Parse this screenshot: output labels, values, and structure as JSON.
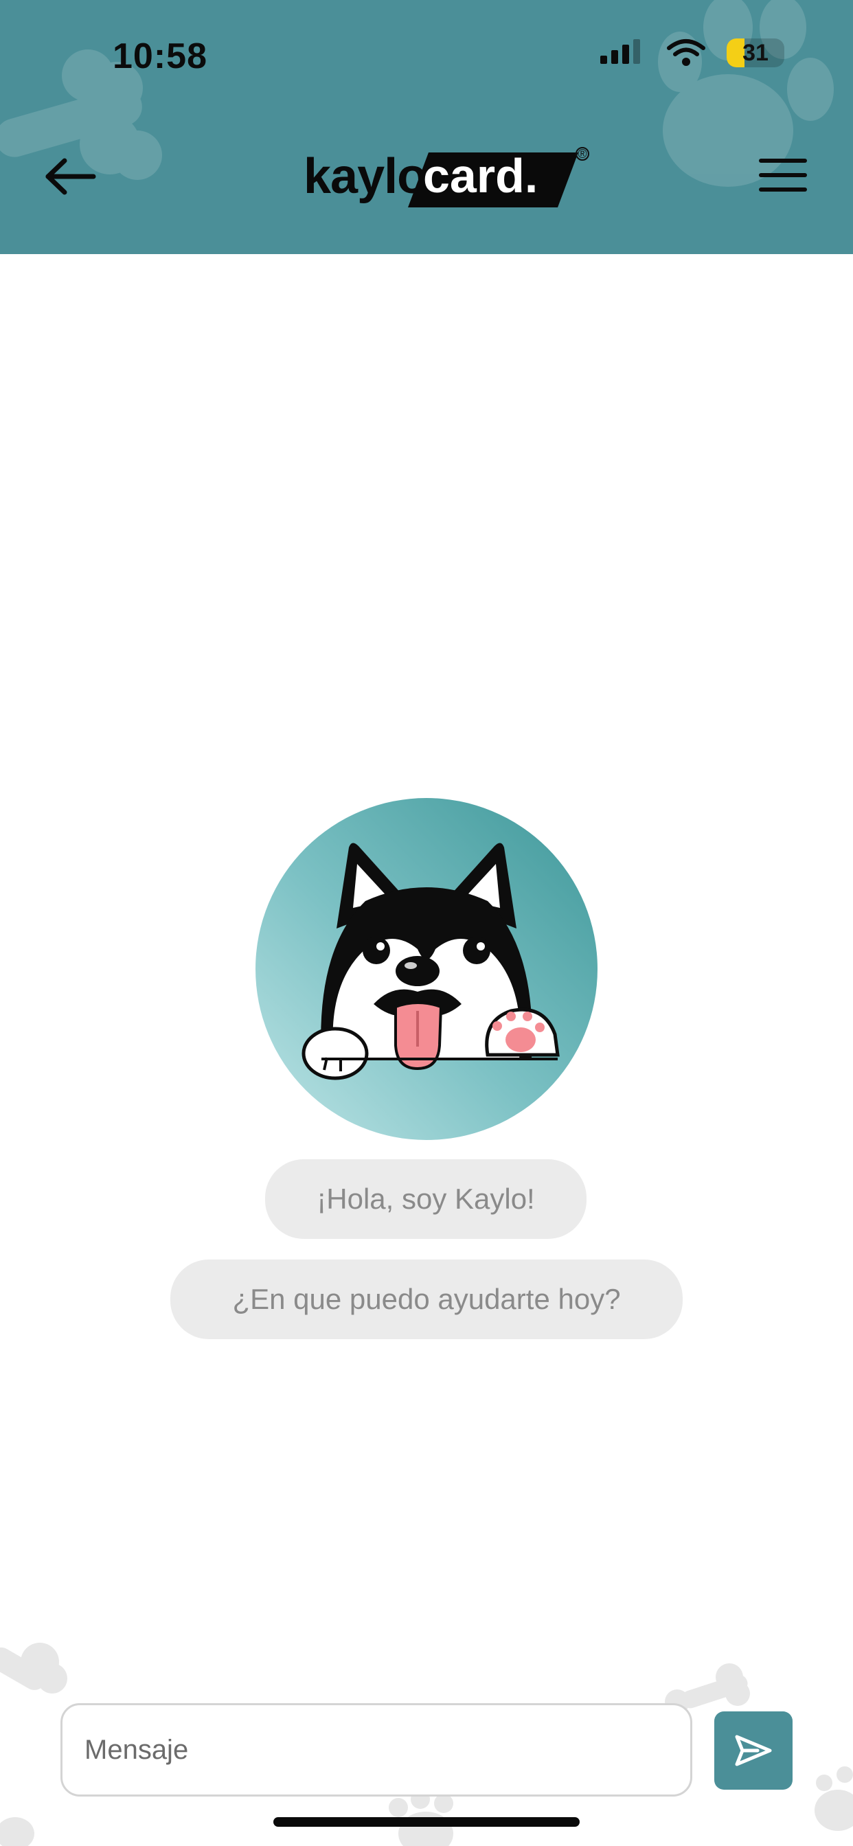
{
  "status_bar": {
    "time": "10:58",
    "battery_level": "31",
    "battery_fraction": 0.31,
    "icons": [
      "cellular-signal-icon",
      "wifi-icon",
      "battery-icon"
    ]
  },
  "header": {
    "logo": {
      "text_left": "kaylo",
      "text_right": "card."
    },
    "back_icon": "arrow-left-icon",
    "menu_icon": "hamburger-menu-icon"
  },
  "chat": {
    "bot_avatar": "husky-dog-mascot",
    "messages": [
      {
        "text": "¡Hola, soy Kaylo!"
      },
      {
        "text": "¿En que puedo ayudarte hoy?"
      }
    ]
  },
  "composer": {
    "placeholder": "Mensaje",
    "value": "",
    "send_icon": "send-icon"
  },
  "colors": {
    "header_bg": "#4b8f98",
    "accent": "#4b8f98",
    "bubble_bg": "#ebebeb",
    "bubble_text": "#8a8a8a"
  }
}
